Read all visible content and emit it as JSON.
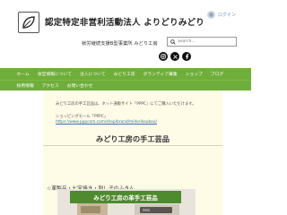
{
  "header": {
    "org_title": "認定特定非営利活動法人 よりどりみどり",
    "login_label": "ログイン",
    "subtitle": "就労継続支援B型事業所 みどり工房",
    "search_placeholder": "Search..."
  },
  "social": [
    "instagram-icon",
    "x-icon",
    "facebook-icon"
  ],
  "nav": {
    "row1": [
      "ホーム",
      "食堂情報について",
      "注入について",
      "みどり工房",
      "ボランティア募集",
      "ショップ",
      "ブログ"
    ],
    "row2": [
      "採用情報",
      "アクセス",
      "お問い合わせ"
    ]
  },
  "content": {
    "intro_line": "みどり工房の手工芸品は、ネット通販サイト「PPPC」にてご購入いただけます。",
    "shop_label": "ショッピングモール「PPPC」",
    "shop_url": "https://www.pppcom.com/shop/brand/midorikoubou/",
    "section_heading": "みどり工房の手工芸品",
    "product_line": "☆革製品・七宝焼き・刺し子のふきん",
    "image_banner": "みどり工房の革手工芸品"
  },
  "colors": {
    "nav_green": "#6fae3a",
    "content_bg": "#fefbe7",
    "link_blue": "#3a6fb0"
  }
}
